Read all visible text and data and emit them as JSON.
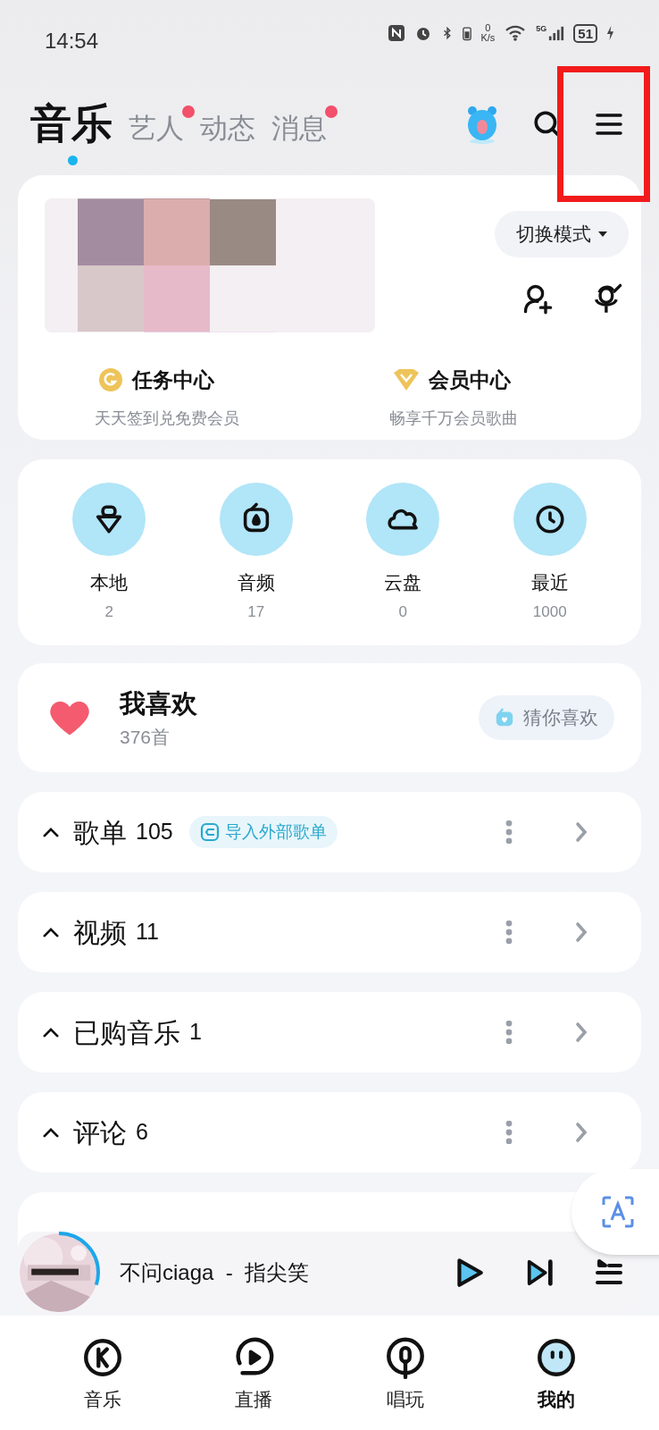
{
  "status_bar": {
    "time": "14:54",
    "net_speed_value": "0",
    "net_speed_unit": "K/s",
    "network": "5G",
    "battery": "51"
  },
  "tabs": [
    {
      "label": "音乐",
      "selected": true,
      "badge": false
    },
    {
      "label": "艺人",
      "selected": false,
      "badge": true
    },
    {
      "label": "动态",
      "selected": false,
      "badge": false
    },
    {
      "label": "消息",
      "selected": false,
      "badge": true
    }
  ],
  "profile": {
    "mode_button": "切换模式",
    "links": [
      {
        "kind": "task",
        "title": "任务中心",
        "subtitle": "天天签到兑免费会员"
      },
      {
        "kind": "vip",
        "title": "会员中心",
        "subtitle": "畅享千万会员歌曲"
      }
    ]
  },
  "shortcuts": [
    {
      "kind": "local",
      "label": "本地",
      "count": "2"
    },
    {
      "kind": "audio",
      "label": "音频",
      "count": "17"
    },
    {
      "kind": "cloud",
      "label": "云盘",
      "count": "0"
    },
    {
      "kind": "recent",
      "label": "最近",
      "count": "1000"
    }
  ],
  "liked": {
    "title": "我喜欢",
    "count": "376首",
    "button": "猜你喜欢"
  },
  "sections": [
    {
      "title": "歌单",
      "count": "105",
      "action": "导入外部歌单"
    },
    {
      "title": "视频",
      "count": "11"
    },
    {
      "title": "已购音乐",
      "count": "1"
    },
    {
      "title": "评论",
      "count": "6"
    }
  ],
  "now_playing": {
    "level": 0.3,
    "title": "不问ciaga  -  指尖笑"
  },
  "bottom_nav": [
    {
      "kind": "k",
      "label": "音乐",
      "selected": false
    },
    {
      "kind": "live",
      "label": "直播",
      "selected": false
    },
    {
      "kind": "mic",
      "label": "唱玩",
      "selected": false
    },
    {
      "kind": "me",
      "label": "我的",
      "selected": true
    }
  ]
}
